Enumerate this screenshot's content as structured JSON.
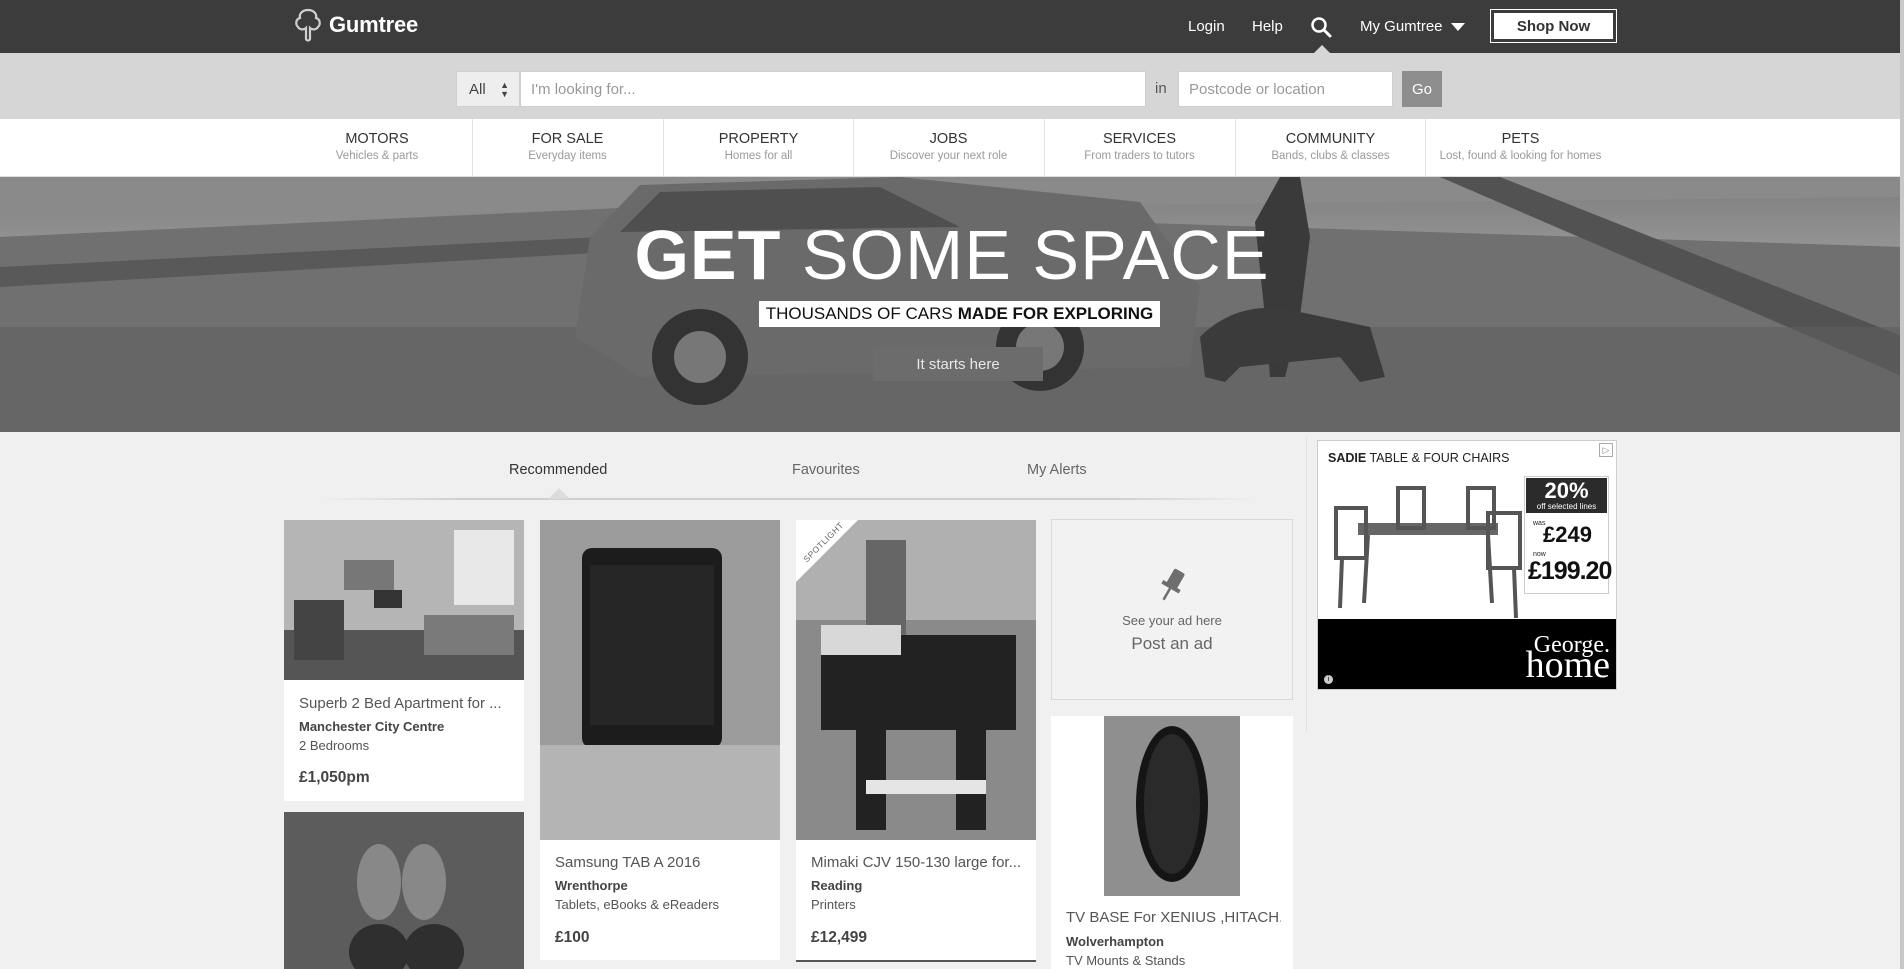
{
  "header": {
    "logo_text": "Gumtree",
    "login": "Login",
    "help": "Help",
    "my_gumtree": "My Gumtree",
    "shop_now": "Shop Now"
  },
  "search": {
    "category": "All",
    "query_placeholder": "I'm looking for...",
    "in_label": "in",
    "location_placeholder": "Postcode or location",
    "go": "Go"
  },
  "categories": [
    {
      "title": "MOTORS",
      "subtitle": "Vehicles & parts"
    },
    {
      "title": "FOR SALE",
      "subtitle": "Everyday items"
    },
    {
      "title": "PROPERTY",
      "subtitle": "Homes for all"
    },
    {
      "title": "JOBS",
      "subtitle": "Discover your next role"
    },
    {
      "title": "SERVICES",
      "subtitle": "From traders to tutors"
    },
    {
      "title": "COMMUNITY",
      "subtitle": "Bands, clubs & classes"
    },
    {
      "title": "PETS",
      "subtitle": "Lost, found & looking for homes"
    }
  ],
  "hero": {
    "title_bold": "GET",
    "title_rest": "SOME SPACE",
    "subtitle_plain": "THOUSANDS OF CARS",
    "subtitle_bold": "MADE FOR EXPLORING",
    "button": "It starts here"
  },
  "tabs": {
    "recommended": "Recommended",
    "favourites": "Favourites",
    "alerts": "My Alerts"
  },
  "listings": [
    {
      "title": "Superb 2 Bed Apartment for ...",
      "location": "Manchester City Centre",
      "category": "2 Bedrooms",
      "price": "£1,050pm"
    },
    {
      "title": "Samsung TAB A 2016",
      "location": "Wrenthorpe",
      "category": "Tablets, eBooks & eReaders",
      "price": "£100"
    },
    {
      "title": "Mimaki CJV 150-130 large for...",
      "location": "Reading",
      "category": "Printers",
      "price": "£12,499",
      "badge": "SPOTLIGHT"
    },
    {
      "title": "TV BASE For XENIUS ,HITACH...",
      "location": "Wolverhampton",
      "category": "TV Mounts & Stands"
    }
  ],
  "post_ad": {
    "hint": "See your ad here",
    "link": "Post an ad"
  },
  "ad": {
    "brand_bold": "SADIE",
    "headline": "TABLE & FOUR CHAIRS",
    "discount": "20%",
    "discount_note": "off selected lines",
    "was_label": "was",
    "was_price": "£249",
    "now_label": "now",
    "now_price": "£199.20",
    "brand_line1": "George.",
    "brand_line2": "home"
  },
  "colors": {
    "topbar": "#3c3c3c",
    "searchbar": "#d6d6d6",
    "page_bg": "#f0f0f0"
  }
}
